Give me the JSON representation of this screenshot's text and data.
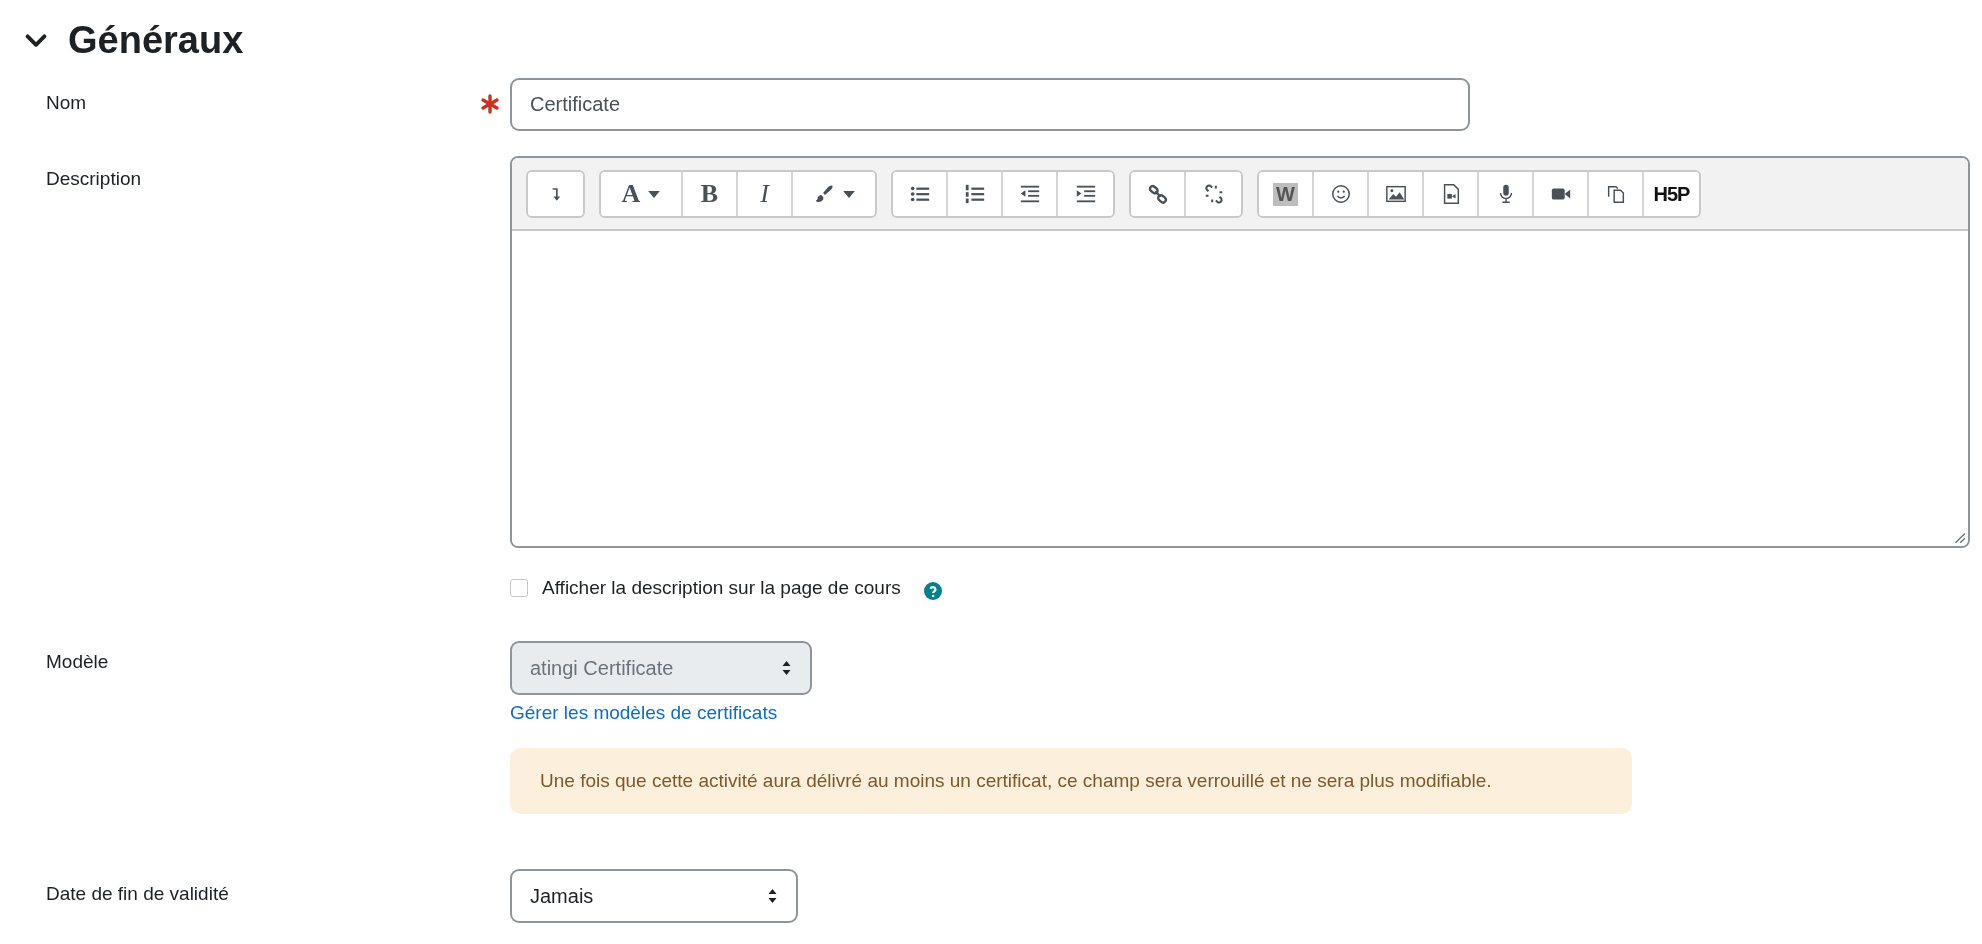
{
  "section": {
    "title": "Généraux",
    "expanded": true
  },
  "name_field": {
    "label": "Nom",
    "required": true,
    "value": "Certificate"
  },
  "description": {
    "label": "Description",
    "toolbar": [
      {
        "buttons": [
          {
            "kind": "collapse"
          }
        ]
      },
      {
        "buttons": [
          {
            "kind": "font",
            "glyph": "A",
            "dropdown": true
          },
          {
            "kind": "bold",
            "glyph": "B"
          },
          {
            "kind": "italic",
            "glyph": "I"
          },
          {
            "kind": "color",
            "dropdown": true
          }
        ]
      },
      {
        "buttons": [
          {
            "kind": "bullets"
          },
          {
            "kind": "numbers"
          },
          {
            "kind": "outdent"
          },
          {
            "kind": "indent"
          }
        ]
      },
      {
        "buttons": [
          {
            "kind": "link"
          },
          {
            "kind": "unlink"
          }
        ]
      },
      {
        "buttons": [
          {
            "kind": "word",
            "glyph": "W"
          },
          {
            "kind": "emoji"
          },
          {
            "kind": "image"
          },
          {
            "kind": "media-file"
          },
          {
            "kind": "mic"
          },
          {
            "kind": "video"
          },
          {
            "kind": "copy"
          },
          {
            "kind": "h5p",
            "glyph": "H5P"
          }
        ]
      }
    ]
  },
  "show_description": {
    "label": "Afficher la description sur la page de cours",
    "checked": false
  },
  "template": {
    "label": "Modèle",
    "value": "atingi Certificate",
    "disabled": true,
    "link": "Gérer les modèles de certificats",
    "warning": "Une fois que cette activité aura délivré au moins un certificat, ce champ sera verrouillé et ne sera plus modifiable."
  },
  "expiry": {
    "label": "Date de fin de validité",
    "value": "Jamais"
  }
}
